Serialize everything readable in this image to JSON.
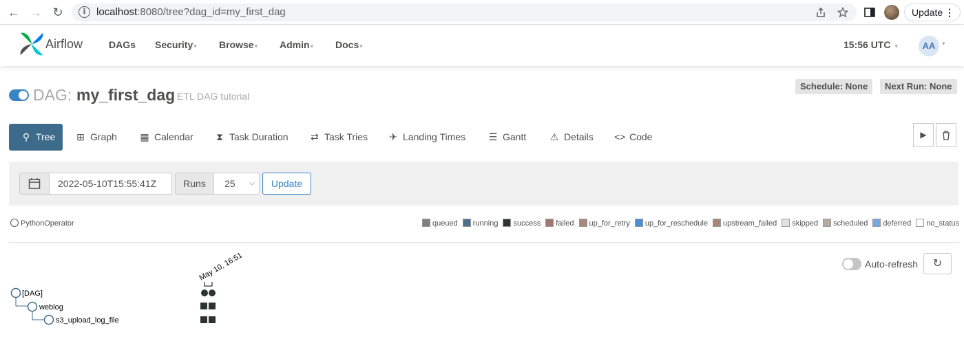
{
  "browser": {
    "url_host": "localhost",
    "url_rest": ":8080/tree?dag_id=my_first_dag",
    "update_label": "Update"
  },
  "navbar": {
    "brand": "Airflow",
    "items": [
      {
        "label": "DAGs",
        "dropdown": false
      },
      {
        "label": "Security",
        "dropdown": true
      },
      {
        "label": "Browse",
        "dropdown": true
      },
      {
        "label": "Admin",
        "dropdown": true
      },
      {
        "label": "Docs",
        "dropdown": true
      }
    ],
    "clock": "15:56 UTC",
    "avatar_initials": "AA"
  },
  "dag": {
    "prefix": "DAG:",
    "name": "my_first_dag",
    "description": "ETL DAG tutorial",
    "schedule": "Schedule: None",
    "next_run": "Next Run: None",
    "paused": false
  },
  "tabs": [
    {
      "label": "Tree",
      "icon": "tree-icon",
      "active": true
    },
    {
      "label": "Graph",
      "icon": "graph-icon",
      "active": false
    },
    {
      "label": "Calendar",
      "icon": "calendar-icon",
      "active": false
    },
    {
      "label": "Task Duration",
      "icon": "hourglass-icon",
      "active": false
    },
    {
      "label": "Task Tries",
      "icon": "retry-icon",
      "active": false
    },
    {
      "label": "Landing Times",
      "icon": "plane-landing-icon",
      "active": false
    },
    {
      "label": "Gantt",
      "icon": "gantt-icon",
      "active": false
    },
    {
      "label": "Details",
      "icon": "warning-icon",
      "active": false
    },
    {
      "label": "Code",
      "icon": "code-icon",
      "active": false
    }
  ],
  "filters": {
    "base_date": "2022-05-10T15:55:41Z",
    "runs_label": "Runs",
    "runs_value": "25",
    "update_label": "Update"
  },
  "legend": {
    "operator": "PythonOperator",
    "states": [
      {
        "label": "queued",
        "color": "#808080"
      },
      {
        "label": "running",
        "color": "#4d6e8c"
      },
      {
        "label": "success",
        "color": "#2b3530"
      },
      {
        "label": "failed",
        "color": "#a07a70"
      },
      {
        "label": "up_for_retry",
        "color": "#a88a7c"
      },
      {
        "label": "up_for_reschedule",
        "color": "#4a8fd4"
      },
      {
        "label": "upstream_failed",
        "color": "#a8877a"
      },
      {
        "label": "skipped",
        "color": "#e0e0e0"
      },
      {
        "label": "scheduled",
        "color": "#b5aba2"
      },
      {
        "label": "deferred",
        "color": "#78a8e0"
      },
      {
        "label": "no_status",
        "color": "#ffffff"
      }
    ]
  },
  "tree": {
    "autorefresh_label": "Auto-refresh",
    "autorefresh": false,
    "run_label": "May 10, 16:51",
    "nodes": [
      {
        "label": "[DAG]",
        "depth": 0
      },
      {
        "label": "weblog",
        "depth": 1
      },
      {
        "label": "s3_upload_log_file",
        "depth": 2
      }
    ]
  }
}
